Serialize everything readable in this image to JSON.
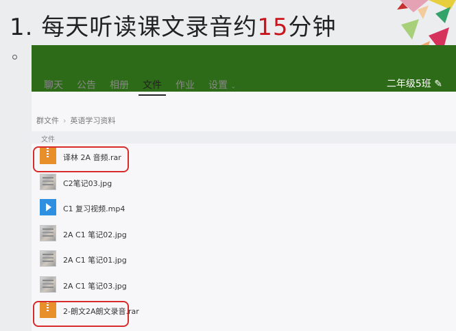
{
  "slide": {
    "title_prefix": "1. 每天听读课文录音约",
    "title_highlight": "15",
    "title_suffix": "分钟",
    "highlight_color": "#c9141c"
  },
  "group": {
    "name": "二年级5班",
    "bar_color": "#2e6b18"
  },
  "tabs": [
    {
      "label": "聊天",
      "active": false
    },
    {
      "label": "公告",
      "active": false
    },
    {
      "label": "相册",
      "active": false
    },
    {
      "label": "文件",
      "active": true
    },
    {
      "label": "作业",
      "active": false
    },
    {
      "label": "设置",
      "active": false
    }
  ],
  "breadcrumb": {
    "root": "群文件",
    "current": "英语学习资料"
  },
  "file_list": {
    "column_header": "文件",
    "files": [
      {
        "name": "译林 2A 音频.rar",
        "type": "rar",
        "icon": "archive-icon",
        "highlighted": true
      },
      {
        "name": "C2笔记03.jpg",
        "type": "jpg",
        "icon": "image-thumbnail",
        "highlighted": false
      },
      {
        "name": "C1 复习视频.mp4",
        "type": "mp4",
        "icon": "video-play-icon",
        "highlighted": false
      },
      {
        "name": "2A C1 笔记02.jpg",
        "type": "jpg",
        "icon": "image-thumbnail",
        "highlighted": false
      },
      {
        "name": "2A C1 笔记01.jpg",
        "type": "jpg",
        "icon": "image-thumbnail",
        "highlighted": false
      },
      {
        "name": "2A C1 笔记03.jpg",
        "type": "jpg",
        "icon": "image-thumbnail",
        "highlighted": false
      },
      {
        "name": "2-朗文2A朗文录音.rar",
        "type": "rar",
        "icon": "archive-icon",
        "highlighted": true
      }
    ]
  },
  "annotation_color": "#d92a2a"
}
